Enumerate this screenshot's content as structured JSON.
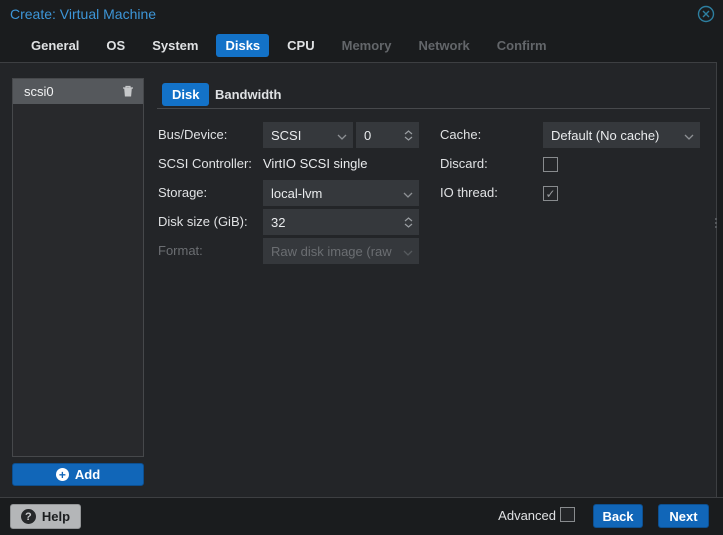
{
  "window": {
    "title": "Create: Virtual Machine"
  },
  "tabs": [
    {
      "label": "General",
      "state": "normal"
    },
    {
      "label": "OS",
      "state": "normal"
    },
    {
      "label": "System",
      "state": "normal"
    },
    {
      "label": "Disks",
      "state": "active"
    },
    {
      "label": "CPU",
      "state": "normal"
    },
    {
      "label": "Memory",
      "state": "disabled"
    },
    {
      "label": "Network",
      "state": "disabled"
    },
    {
      "label": "Confirm",
      "state": "disabled"
    }
  ],
  "sidebar": {
    "items": [
      {
        "label": "scsi0",
        "selected": true
      }
    ],
    "add_label": "Add"
  },
  "subtabs": [
    {
      "label": "Disk",
      "active": true
    },
    {
      "label": "Bandwidth",
      "active": false
    }
  ],
  "form": {
    "bus_device": {
      "label": "Bus/Device:",
      "bus": "SCSI",
      "device": "0"
    },
    "scsi_controller": {
      "label": "SCSI Controller:",
      "value": "VirtIO SCSI single"
    },
    "storage": {
      "label": "Storage:",
      "value": "local-lvm"
    },
    "disk_size": {
      "label": "Disk size (GiB):",
      "value": "32"
    },
    "format": {
      "label": "Format:",
      "value": "Raw disk image (raw",
      "disabled": true
    },
    "cache": {
      "label": "Cache:",
      "value": "Default (No cache)"
    },
    "discard": {
      "label": "Discard:",
      "checked": false
    },
    "io_thread": {
      "label": "IO thread:",
      "checked": true
    }
  },
  "footer": {
    "help_label": "Help",
    "advanced_label": "Advanced",
    "advanced_checked": false,
    "back_label": "Back",
    "next_label": "Next"
  },
  "icons": {
    "close": "circle-x",
    "trash": "trash-can",
    "add_glyph": "+",
    "help_glyph": "?",
    "check_glyph": "✓"
  },
  "colors": {
    "title_blue": "#3d96d8",
    "accent_blue": "#1372c8",
    "button_blue": "#1166b8",
    "content_bg": "#232528",
    "field_bg": "#35383c",
    "selected_item_bg": "#55585c",
    "close_teal": "#2d7fa0"
  }
}
